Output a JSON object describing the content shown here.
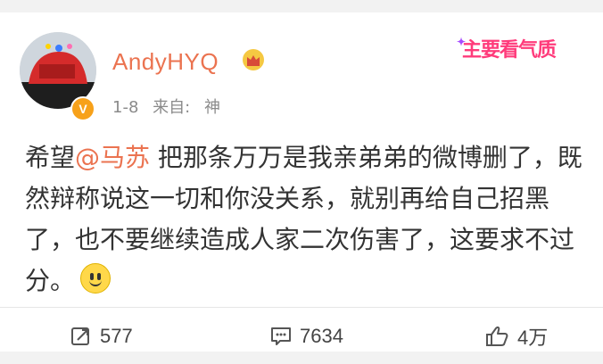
{
  "post": {
    "author": "AndyHYQ",
    "time": "1-8",
    "source_label": "来自:",
    "source": "神",
    "content": {
      "before_mention": "希望",
      "mention": "@马苏",
      "after_mention": " 把那条万万是我亲弟弟的微博删了，既然辩称说这一切和你没关系，就别再给自己招黑了，也不要继续造成人家二次伤害了，这要求不过分。"
    }
  },
  "actions": {
    "repost_count": "577",
    "comment_count": "7634",
    "like_count": "4万"
  },
  "watermark": "主要看气质",
  "colors": {
    "accent": "#eb7350",
    "text": "#333333",
    "meta": "#8a8a8a",
    "verified": "#f7a11a",
    "watermark": "#ff3b7b"
  },
  "icons": [
    "verified-icon",
    "crown-icon",
    "repost-icon",
    "comment-icon",
    "like-icon",
    "smile-emoji-icon"
  ]
}
